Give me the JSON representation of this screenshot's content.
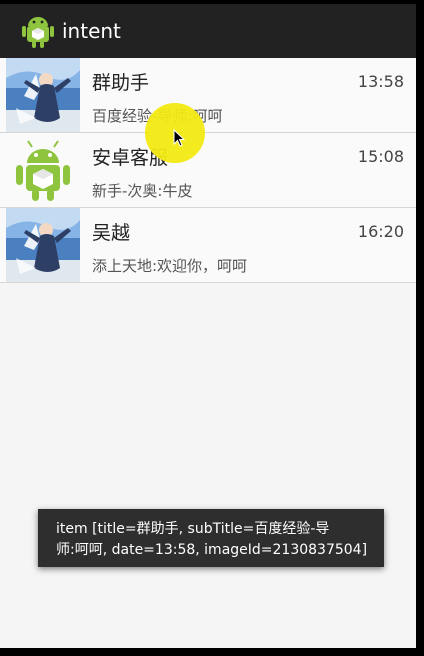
{
  "app": {
    "title": "intent",
    "icon": "android-app-icon"
  },
  "list": {
    "items": [
      {
        "title": "群助手",
        "subtitle": "百度经验-导师:呵呵",
        "date": "13:58",
        "avatar": "photo-avatar"
      },
      {
        "title": "安卓客服",
        "subtitle": "新手-次奥:牛皮",
        "date": "15:08",
        "avatar": "android-avatar"
      },
      {
        "title": "吴越",
        "subtitle": "添上天地:欢迎你，呵呵",
        "date": "16:20",
        "avatar": "photo-avatar"
      }
    ]
  },
  "toast": {
    "line1": "item [title=群助手, subTitle=百度经验-导",
    "line2": "师:呵呵, date=13:58, imageId=2130837504]"
  },
  "colors": {
    "actionbar": "#222222",
    "list_background": "#fafafa",
    "touch_indicator": "#f2ea12",
    "android_green": "#8ec43e",
    "toast_background": "#2e2e2e"
  }
}
